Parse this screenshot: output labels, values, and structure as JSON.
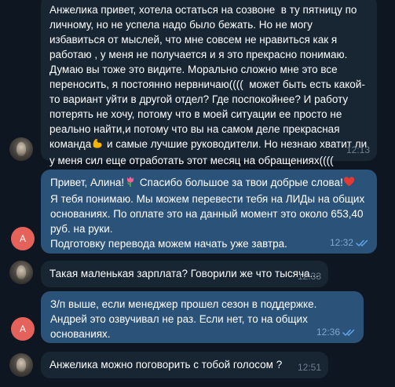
{
  "messages": [
    {
      "sender": "contact",
      "text": "Анжелика привет, хотела остаться на созвоне  в ту пятницу по личному, но не успела надо было бежать. Но не могу избавиться от мыслей, что мне совсем не нравиться как я работаю , у меня не получается и я это прекрасно понимаю. Думаю вы тоже это видите. Морально сложно мне это все переносить, я постоянно нервничаю((((  может быть есть какой-то вариант уйти в другой отдел? Где поспокойнее? И работу потерять не хочу, потому что в моей ситуации ее просто не реально найти,и потому что вы на самом деле прекрасная команда",
      "text_after_emoji": " и самые лучшие руководители. Но незнаю хватит ли у меня сил еще отработать этот месяц на обращениях((((",
      "emoji": "muscle-emoji",
      "time": "12:13"
    },
    {
      "sender": "me",
      "avatar_letter": "A",
      "line1_pre": "Привет, Алина!",
      "line1_mid": " Спасибо большое за твои добрые слова!",
      "emoji_tulip": "tulip-emoji",
      "emoji_heart": "heart-emoji",
      "body": "Я тебя понимаю. Мы можем перевести тебя на ЛИДы на общих основаниях. По оплате это на данный момент это около 653,40 руб. на руки.\nПодготовку перевода можем начать уже завтра.",
      "time": "12:32",
      "status": "read"
    },
    {
      "sender": "contact",
      "text": "Такая маленькая зарплата? Говорили же что тысяча...",
      "time": "12:33"
    },
    {
      "sender": "me",
      "avatar_letter": "A",
      "text": "З/п выше, если менеджер прошел сезон в поддержке. Андрей это озвучивал не раз. Если нет, то на общих основаниях.",
      "time": "12:36",
      "status": "read"
    },
    {
      "sender": "contact",
      "text": "Анжелика можно поговорить с тобой голосом ?",
      "time": "12:51"
    }
  ],
  "colors": {
    "background": "#0e1621",
    "incoming_bubble": "#182533",
    "outgoing_bubble": "#2b5278",
    "letter_avatar": "#e5625b",
    "read_check": "#5fa5e6"
  }
}
